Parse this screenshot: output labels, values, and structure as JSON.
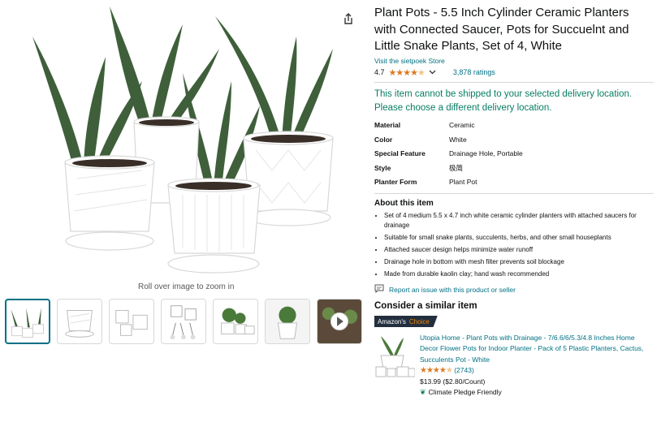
{
  "gallery": {
    "rollover_text": "Roll over image to zoom in",
    "thumbnails": [
      "thumb-1",
      "thumb-2",
      "thumb-3",
      "thumb-4",
      "thumb-5",
      "thumb-6",
      "thumb-7"
    ],
    "selected_index": 0
  },
  "product": {
    "title": "Plant Pots - 5.5 Inch Cylinder Ceramic Planters with Connected Saucer, Pots for Succuelnt and Little Snake Plants, Set of 4, White",
    "store_link": "Visit the sietpoek Store",
    "rating_value": "4.7",
    "rating_stars": 4.5,
    "rating_count": "3,878 ratings",
    "shipping_message": "This item cannot be shipped to your selected delivery location. Please choose a different delivery location.",
    "specs": [
      {
        "key": "Material",
        "value": "Ceramic"
      },
      {
        "key": "Color",
        "value": "White"
      },
      {
        "key": "Special Feature",
        "value": "Drainage Hole, Portable"
      },
      {
        "key": "Style",
        "value": "极简"
      },
      {
        "key": "Planter Form",
        "value": "Plant Pot"
      }
    ],
    "about_heading": "About this item",
    "bullets": [
      "Set of 4 medium 5.5 x 4.7 inch white ceramic cylinder planters with attached saucers for drainage",
      "Suitable for small snake plants, succulents, herbs, and other small houseplants",
      "Attached saucer design helps minimize water runoff",
      "Drainage hole in bottom with mesh filter prevents soil blockage",
      "Made from durable kaolin clay; hand wash recommended"
    ],
    "report_link": "Report an issue with this product or seller"
  },
  "similar": {
    "heading": "Consider a similar item",
    "badge_left": "Amazon's",
    "badge_right": "Choice",
    "title": "Utopia Home - Plant Pots with Drainage - 7/6.6/6/5.3/4.8 Inches Home Decor Flower Pots for Indoor Planter - Pack of 5 Plastic Planters, Cactus, Succulents Pot - White",
    "stars": 4.5,
    "rating_count": "(2743)",
    "price": "$13.99 ($2.80/Count)",
    "climate": "Climate Pledge Friendly"
  },
  "colors": {
    "link": "#007185",
    "star": "#de7921",
    "ship": "#067d62"
  }
}
